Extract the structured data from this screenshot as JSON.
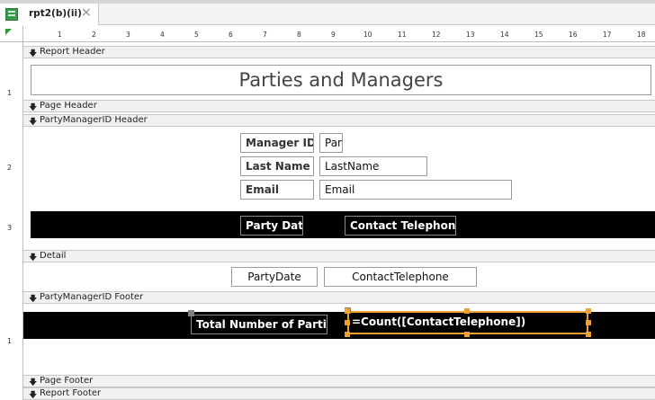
{
  "tab": {
    "label": "rpt2(b)(ii)",
    "close": "×",
    "icon": "report-icon"
  },
  "ruler": {
    "numbers": [
      "1",
      "2",
      "3",
      "4",
      "5",
      "6",
      "7",
      "8",
      "9",
      "10",
      "11",
      "12",
      "13",
      "14",
      "15",
      "16",
      "17",
      "18"
    ],
    "vertical": [
      "1",
      "2",
      "3",
      "1"
    ]
  },
  "sections": {
    "report_header": "Report Header",
    "page_header": "Page Header",
    "group_header": "PartyManagerID Header",
    "detail": "Detail",
    "group_footer": "PartyManagerID Footer",
    "page_footer": "Page Footer",
    "report_footer": "Report Footer"
  },
  "report_title": "Parties and Managers",
  "group_header_controls": {
    "manager_id_label": "Manager ID",
    "manager_id_field": "Par",
    "last_name_label": "Last Name",
    "last_name_field": "LastName",
    "email_label": "Email",
    "email_field": "Email",
    "party_date_label": "Party Date",
    "contact_telephone_label": "Contact Telephone"
  },
  "detail_controls": {
    "party_date_field": "PartyDate",
    "contact_telephone_field": "ContactTelephone"
  },
  "group_footer_controls": {
    "total_label": "Total Number of Parties",
    "count_expression": "=Count([ContactTelephone])"
  },
  "colors": {
    "band_black": "#000000",
    "selection": "#f0a030",
    "section_bar": "#f1f1f1"
  }
}
